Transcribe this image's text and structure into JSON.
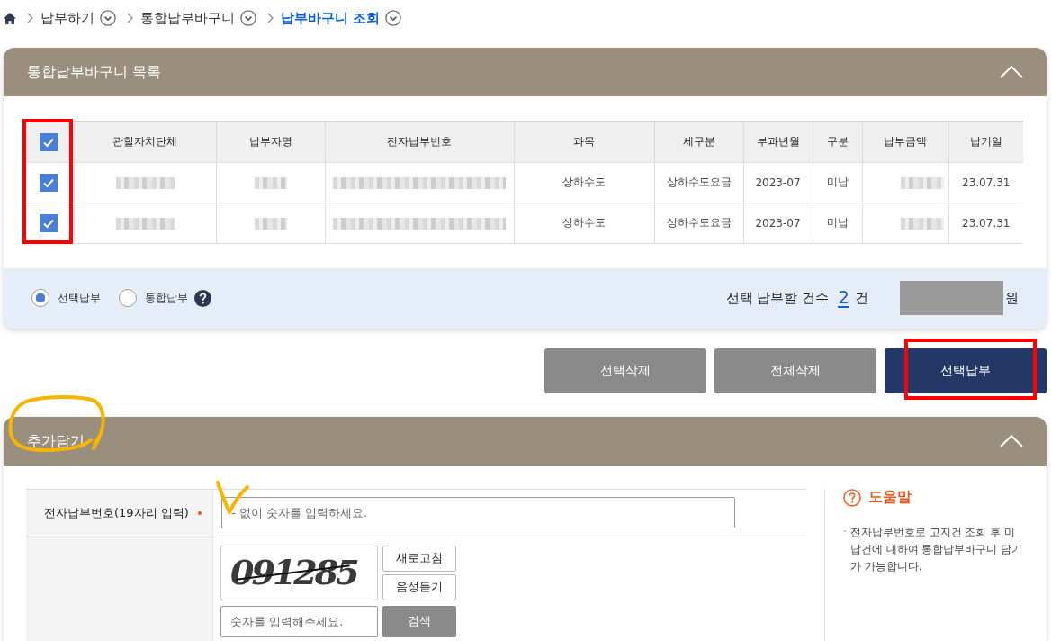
{
  "breadcrumb": [
    {
      "kind": "home"
    },
    {
      "kind": "link",
      "label": "납부하기",
      "current": false
    },
    {
      "kind": "link",
      "label": "통합납부바구니",
      "current": false
    },
    {
      "kind": "link",
      "label": "납부바구니 조회",
      "current": true
    }
  ],
  "basket_panel": {
    "title": "통합납부바구니 목록",
    "expanded": true,
    "table": {
      "highlighted": true,
      "all_checked": true,
      "columns": [
        "관할자치단체",
        "납부자명",
        "전자납부번호",
        "과목",
        "세구분",
        "부과년월",
        "구분",
        "납부금액",
        "납기일"
      ],
      "rows": [
        {
          "checked": true,
          "cells": [
            {
              "kind": "blurred"
            },
            {
              "kind": "blurred"
            },
            {
              "kind": "blurred"
            },
            {
              "kind": "text",
              "text": "상하수도"
            },
            {
              "kind": "text",
              "text": "상하수도요금"
            },
            {
              "kind": "text",
              "text": "2023-07"
            },
            {
              "kind": "text",
              "text": "미납"
            },
            {
              "kind": "blurred"
            },
            {
              "kind": "text",
              "text": "23.07.31"
            }
          ]
        },
        {
          "checked": true,
          "cells": [
            {
              "kind": "blurred"
            },
            {
              "kind": "blurred"
            },
            {
              "kind": "blurred"
            },
            {
              "kind": "text",
              "text": "상하수도"
            },
            {
              "kind": "text",
              "text": "상하수도요금"
            },
            {
              "kind": "text",
              "text": "2023-07"
            },
            {
              "kind": "text",
              "text": "미납"
            },
            {
              "kind": "blurred"
            },
            {
              "kind": "text",
              "text": "23.07.31"
            }
          ]
        }
      ]
    },
    "payment_options": [
      {
        "label": "선택납부",
        "selected": true,
        "help": false
      },
      {
        "label": "통합납부",
        "selected": false,
        "help": true
      }
    ],
    "summary": {
      "label": "선택 납부할 건수",
      "count": "2",
      "count_unit": "건",
      "amount_hidden": true,
      "amount_unit": "원"
    }
  },
  "actions": [
    {
      "label": "선택삭제",
      "kind": "secondary",
      "highlighted": false
    },
    {
      "label": "전체삭제",
      "kind": "secondary",
      "highlighted": false
    },
    {
      "label": "선택납부",
      "kind": "primary",
      "highlighted": true
    }
  ],
  "add_panel": {
    "title": "추가담기",
    "title_circled": true,
    "expanded": true,
    "form": {
      "payment_number": {
        "label": "전자납부번호(19자리 입력)",
        "required": true,
        "placeholder": "- 없이 숫자를 입력하세요.",
        "check_marked": true
      },
      "captcha": {
        "text": "091285",
        "struck_through": true,
        "refresh": "새로고침",
        "listen": "음성듣기",
        "placeholder": "숫자를 입력해주세요.",
        "submit": "검색"
      }
    },
    "help": {
      "title": "도움말",
      "bullet": "·",
      "text": "전자납부번호로 고지건 조회 후 미납건에 대하여 통합납부바구니 담기가 가능합니다."
    }
  }
}
